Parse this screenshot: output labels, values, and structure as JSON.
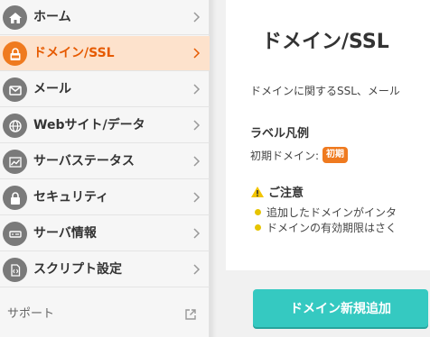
{
  "sidebar": {
    "items": [
      {
        "label": "ホーム",
        "icon": "home-icon"
      },
      {
        "label": "ドメイン/SSL",
        "icon": "ssl-lock-icon",
        "active": true
      },
      {
        "label": "メール",
        "icon": "mail-icon"
      },
      {
        "label": "Webサイト/データ",
        "icon": "globe-icon"
      },
      {
        "label": "サーバステータス",
        "icon": "chart-icon"
      },
      {
        "label": "セキュリティ",
        "icon": "lock-icon"
      },
      {
        "label": "サーバ情報",
        "icon": "server-icon"
      },
      {
        "label": "スクリプト設定",
        "icon": "script-icon"
      }
    ],
    "support_label": "サポート",
    "active_color": "#ef7a1f",
    "active_bg": "#fde2cc"
  },
  "main": {
    "title": "ドメイン/SSL",
    "description": "ドメインに関するSSL、メール",
    "legend_title": "ラベル凡例",
    "legend_item_label": "初期ドメイン:",
    "legend_badge": "初期",
    "caution_title": "ご注意",
    "caution_items": [
      "追加したドメインがインタ",
      "ドメインの有効期限はさく"
    ],
    "cta_label": "ドメイン新規追加",
    "cta_color": "#35c9c1"
  }
}
